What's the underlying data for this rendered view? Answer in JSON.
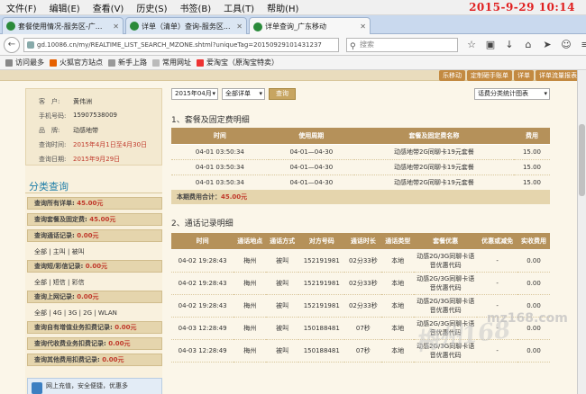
{
  "menu": [
    "文件(F)",
    "编辑(E)",
    "查看(V)",
    "历史(S)",
    "书签(B)",
    "工具(T)",
    "帮助(H)"
  ],
  "clock": "2015-9-29 10:14",
  "tabs": [
    {
      "label": "套餐使用情况-服务区-广..."
    },
    {
      "label": "详单（清单）查询-服务区..."
    },
    {
      "label": "详单查询_广东移动"
    }
  ],
  "url": "gd.10086.cn/my/REALTIME_LIST_SEARCH_MZONE.shtml?uniqueTag=20150929101431237",
  "search_placeholder": "搜索",
  "bookmarks": [
    "访问最多",
    "火狐官方站点",
    "新手上路",
    "常用网址",
    "爱淘宝（原淘宝特卖）"
  ],
  "banner_links": [
    "乐移动",
    "定制砸手账单",
    "详单",
    "详单流量报表"
  ],
  "info": {
    "customer_label": "客　户:",
    "customer": "黄伟洲",
    "phone_label": "手机号码:",
    "phone": "15907538009",
    "brand_label": "品　牌:",
    "brand": "动感地带",
    "period_label": "查询时间:",
    "period": "2015年4月1日至4月30日",
    "date_label": "查询日期:",
    "date": "2015年9月29日"
  },
  "category": {
    "title": "分类查询",
    "all_detail": "查询所有详单: ",
    "all_detail_amt": "45.00元",
    "package": "查询套餐及固定费: ",
    "package_amt": "45.00元",
    "call": "查询通话记录: ",
    "call_amt": "0.00元",
    "call_filters": "全部 | 主叫 | 被叫",
    "sms": "查询短/彩信记录: ",
    "sms_amt": "0.00元",
    "sms_filters": "全部 | 短信 | 彩信",
    "net": "查询上网记录: ",
    "net_amt": "0.00元",
    "net_filters": "全部 | 4G | 3G | 2G | WLAN",
    "value_added": "查询自有增值业务扣费记录: ",
    "value_added_amt": "0.00元",
    "agency": "查询代收费业务扣费记录: ",
    "agency_amt": "0.00元",
    "other": "查询其他费用扣费记录: ",
    "other_amt": "0.00元",
    "promo": "网上充值，安全便捷，优惠多"
  },
  "controls": {
    "month": "2015年04月",
    "type": "全部详单",
    "query": "查询",
    "chart": "话费分类统计图表"
  },
  "section1": {
    "title": "1、套餐及固定费明细",
    "headers": [
      "时间",
      "使用周期",
      "套餐及固定费名称",
      "费用"
    ],
    "rows": [
      [
        "04-01 03:50:34",
        "04-01—04-30",
        "动感地带2G同聊卡19元套餐",
        "15.00"
      ],
      [
        "04-01 03:50:34",
        "04-01—04-30",
        "动感地带2G同聊卡19元套餐",
        "15.00"
      ],
      [
        "04-01 03:50:34",
        "04-01—04-30",
        "动感地带2G同聊卡19元套餐",
        "15.00"
      ]
    ],
    "total_label": "本期费用合计：",
    "total": "45.00元"
  },
  "section2": {
    "title": "2、通话记录明细",
    "headers": [
      "时间",
      "通话地点",
      "通话方式",
      "对方号码",
      "通话时长",
      "通话类型",
      "套餐优惠",
      "优惠或减免",
      "实收费用"
    ],
    "rows": [
      [
        "04-02 19:28:43",
        "梅州",
        "被叫",
        "152191981",
        "02分33秒",
        "本地",
        "动感2G/3G同聊卡语音优惠代码",
        "-",
        "0.00"
      ],
      [
        "04-02 19:28:43",
        "梅州",
        "被叫",
        "152191981",
        "02分33秒",
        "本地",
        "动感2G/3G同聊卡语音优惠代码",
        "-",
        "0.00"
      ],
      [
        "04-02 19:28:43",
        "梅州",
        "被叫",
        "152191981",
        "02分33秒",
        "本地",
        "动感2G/3G同聊卡语音优惠代码",
        "-",
        "0.00"
      ],
      [
        "04-03 12:28:49",
        "梅州",
        "被叫",
        "150188481",
        "07秒",
        "本地",
        "动感2G/3G同聊卡语音优惠代码",
        "-",
        "0.00"
      ],
      [
        "04-03 12:28:49",
        "梅州",
        "被叫",
        "150188481",
        "07秒",
        "本地",
        "动感2G/3G同聊卡语音优惠代码",
        "-",
        "0.00"
      ]
    ]
  },
  "watermark": "梅州168",
  "watermark2": "mz168.com"
}
